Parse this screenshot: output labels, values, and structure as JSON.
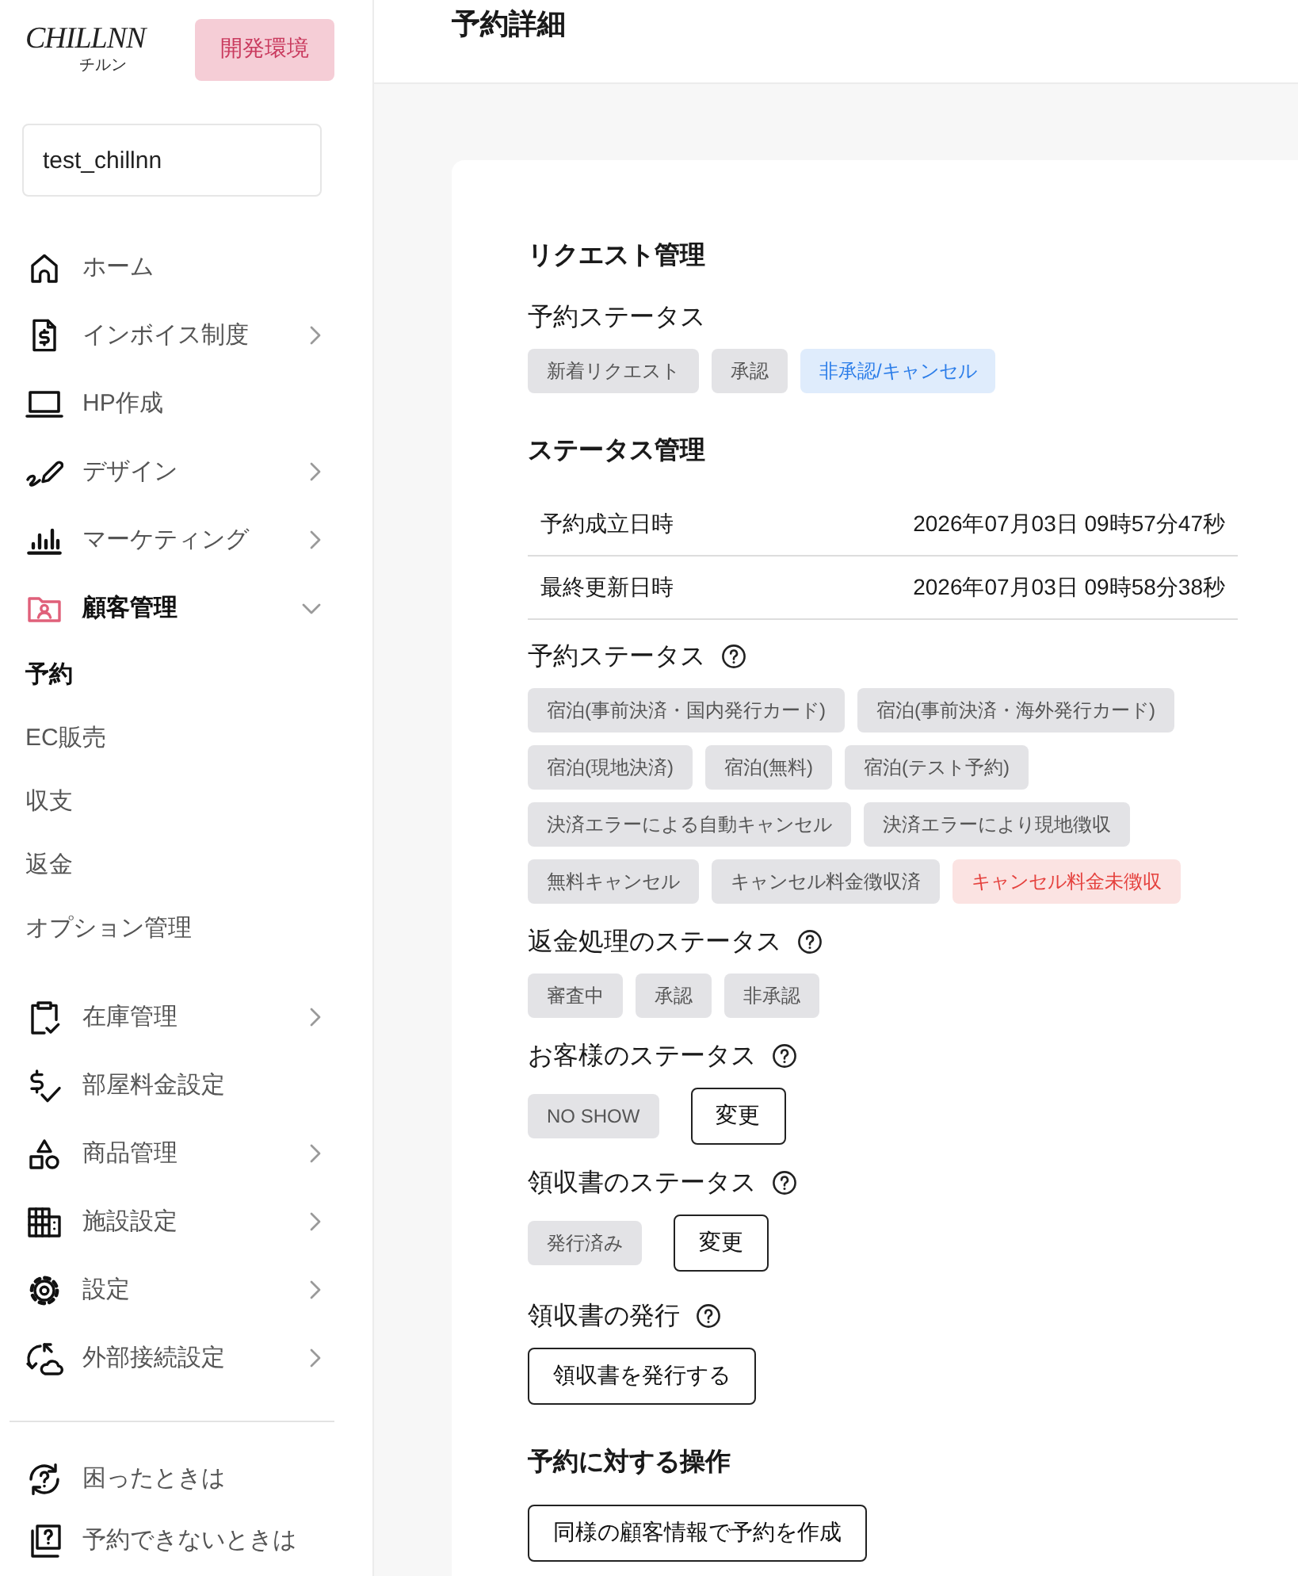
{
  "sidebar": {
    "logo": {
      "text": "CHILLNN",
      "subtext": "チルン"
    },
    "env_badge": "開発環境",
    "account": "test_chillnn",
    "nav": [
      {
        "label": "ホーム",
        "kind": "link",
        "selected": false
      },
      {
        "label": "インボイス制度",
        "kind": "group",
        "selected": false,
        "expanded": false
      },
      {
        "label": "HP作成",
        "kind": "link",
        "selected": false
      },
      {
        "label": "デザイン",
        "kind": "group",
        "selected": false,
        "expanded": false
      },
      {
        "label": "マーケティング",
        "kind": "group",
        "selected": false,
        "expanded": false
      },
      {
        "label": "顧客管理",
        "kind": "group",
        "selected": true,
        "expanded": true,
        "children": [
          {
            "label": "予約",
            "selected": true
          },
          {
            "label": "EC販売",
            "selected": false
          },
          {
            "label": "収支",
            "selected": false
          },
          {
            "label": "返金",
            "selected": false
          },
          {
            "label": "オプション管理",
            "selected": false
          }
        ]
      },
      {
        "label": "在庫管理",
        "kind": "group",
        "selected": false,
        "expanded": false
      },
      {
        "label": "部屋料金設定",
        "kind": "link",
        "selected": false
      },
      {
        "label": "商品管理",
        "kind": "group",
        "selected": false,
        "expanded": false
      },
      {
        "label": "施設設定",
        "kind": "group",
        "selected": false,
        "expanded": false
      },
      {
        "label": "設定",
        "kind": "group",
        "selected": false,
        "expanded": false
      },
      {
        "label": "外部接続設定",
        "kind": "group",
        "selected": false,
        "expanded": false
      }
    ],
    "help_links": [
      "困ったときは",
      "予約できないときは"
    ]
  },
  "main": {
    "title": "予約詳細",
    "sections": [
      {
        "title": "リクエスト管理",
        "fields": [
          {
            "label": "予約ステータス",
            "help": false,
            "kind": "chips",
            "chips": [
              {
                "label": "新着リクエスト",
                "selected": false
              },
              {
                "label": "承認",
                "selected": false
              },
              {
                "label": "非承認/キャンセル",
                "selected": true,
                "color": "#2b7de9"
              }
            ]
          }
        ]
      },
      {
        "title": "ステータス管理",
        "rows": [
          {
            "label": "予約成立日時",
            "value": "2026年07月03日 09時57分47秒"
          },
          {
            "label": "最終更新日時",
            "value": "2026年07月03日 09時58分38秒"
          }
        ],
        "fields": [
          {
            "label": "予約ステータス",
            "help": true,
            "kind": "chips",
            "chips": [
              {
                "label": "宿泊(事前決済・国内発行カード)",
                "selected": false
              },
              {
                "label": "宿泊(事前決済・海外発行カード)",
                "selected": false
              },
              {
                "label": "宿泊(現地決済)",
                "selected": false
              },
              {
                "label": "宿泊(無料)",
                "selected": false
              },
              {
                "label": "宿泊(テスト予約)",
                "selected": false
              },
              {
                "label": "決済エラーによる自動キャンセル",
                "selected": false
              },
              {
                "label": "決済エラーにより現地徴収",
                "selected": false
              },
              {
                "label": "無料キャンセル",
                "selected": false
              },
              {
                "label": "キャンセル料金徴収済",
                "selected": false
              },
              {
                "label": "キャンセル料金未徴収",
                "selected": true,
                "color": "#e5413d"
              }
            ]
          },
          {
            "label": "返金処理のステータス",
            "help": true,
            "kind": "chips",
            "chips": [
              {
                "label": "審査中",
                "selected": false
              },
              {
                "label": "承認",
                "selected": false
              },
              {
                "label": "非承認",
                "selected": false
              }
            ]
          },
          {
            "label": "お客様のステータス",
            "help": true,
            "kind": "value",
            "value": "NO SHOW",
            "button": "変更"
          },
          {
            "label": "領収書のステータス",
            "help": true,
            "kind": "value",
            "value": "発行済み",
            "button": "変更"
          },
          {
            "label": "領収書の発行",
            "help": true,
            "kind": "action",
            "button": "領収書を発行する"
          }
        ]
      },
      {
        "title": "予約に対する操作",
        "buttons": [
          "同様の顧客情報で予約を作成"
        ]
      }
    ]
  }
}
